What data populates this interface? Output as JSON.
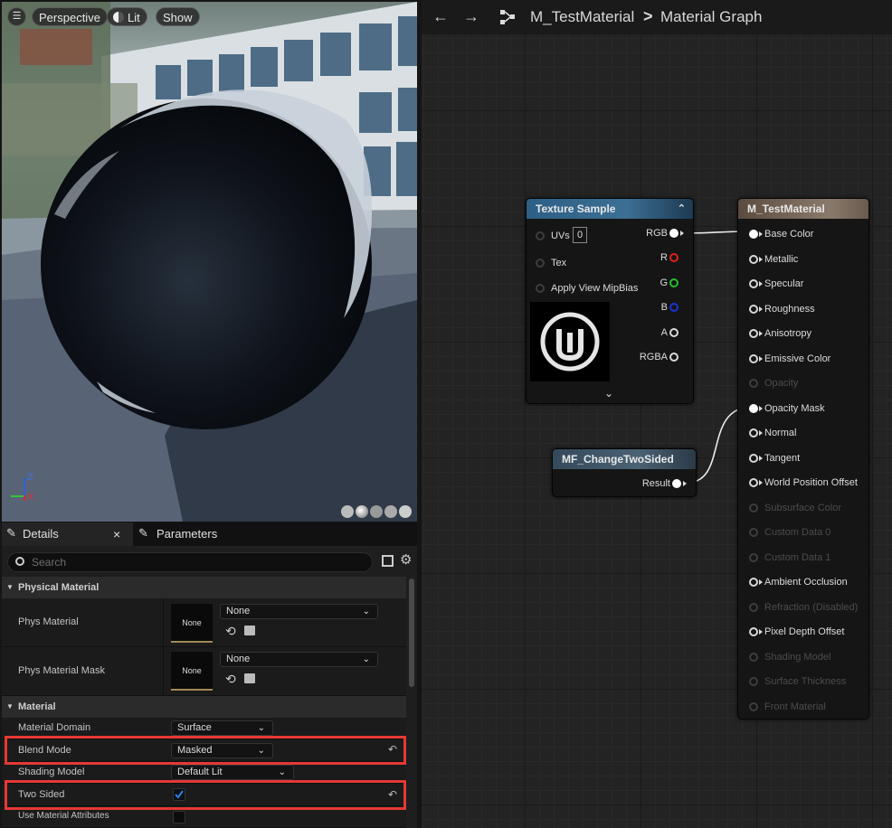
{
  "viewport": {
    "buttons": {
      "perspective": "Perspective",
      "lit": "Lit",
      "show": "Show"
    },
    "axes": {
      "z": "Z",
      "x": "X"
    }
  },
  "details": {
    "tabs": {
      "details": "Details",
      "parameters": "Parameters",
      "close": "×"
    },
    "search_placeholder": "Search",
    "sections": {
      "physical_material": "Physical Material",
      "material": "Material"
    },
    "rows": {
      "phys_material": {
        "label": "Phys Material",
        "thumb": "None",
        "value": "None"
      },
      "phys_material_mask": {
        "label": "Phys Material Mask",
        "thumb": "None",
        "value": "None"
      },
      "material_domain": {
        "label": "Material Domain",
        "value": "Surface"
      },
      "blend_mode": {
        "label": "Blend Mode",
        "value": "Masked"
      },
      "shading_model": {
        "label": "Shading Model",
        "value": "Default Lit"
      },
      "two_sided": {
        "label": "Two Sided",
        "checked": true
      },
      "use_material_attributes": {
        "label": "Use Material Attributes",
        "checked": false
      }
    }
  },
  "graph": {
    "breadcrumb": {
      "asset": "M_TestMaterial",
      "separator": ">",
      "graph": "Material Graph"
    },
    "texture_node": {
      "title": "Texture Sample",
      "uvs": "UVs",
      "uvs_value": "0",
      "tex": "Tex",
      "apply_view_mip_bias": "Apply View MipBias",
      "outputs": [
        "RGB",
        "R",
        "G",
        "B",
        "A",
        "RGBA"
      ]
    },
    "function_node": {
      "title": "MF_ChangeTwoSided",
      "output": "Result"
    },
    "material_node": {
      "title": "M_TestMaterial",
      "inputs": [
        {
          "label": "Base Color",
          "state": "connected"
        },
        {
          "label": "Metallic",
          "state": "active"
        },
        {
          "label": "Specular",
          "state": "active"
        },
        {
          "label": "Roughness",
          "state": "active"
        },
        {
          "label": "Anisotropy",
          "state": "active"
        },
        {
          "label": "Emissive Color",
          "state": "active"
        },
        {
          "label": "Opacity",
          "state": "disabled"
        },
        {
          "label": "Opacity Mask",
          "state": "connected"
        },
        {
          "label": "Normal",
          "state": "active"
        },
        {
          "label": "Tangent",
          "state": "active"
        },
        {
          "label": "World Position Offset",
          "state": "active"
        },
        {
          "label": "Subsurface Color",
          "state": "disabled"
        },
        {
          "label": "Custom Data 0",
          "state": "disabled"
        },
        {
          "label": "Custom Data 1",
          "state": "disabled"
        },
        {
          "label": "Ambient Occlusion",
          "state": "active"
        },
        {
          "label": "Refraction (Disabled)",
          "state": "disabled"
        },
        {
          "label": "Pixel Depth Offset",
          "state": "active"
        },
        {
          "label": "Shading Model",
          "state": "disabled"
        },
        {
          "label": "Surface Thickness",
          "state": "disabled"
        },
        {
          "label": "Front Material",
          "state": "disabled"
        }
      ]
    }
  },
  "colors": {
    "highlight": "#e53935",
    "texture_header": "#2d5f86",
    "material_header": "#5a4a3d",
    "function_header": "#3a5366"
  }
}
